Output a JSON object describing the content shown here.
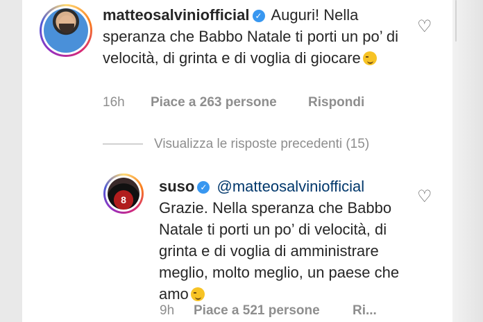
{
  "comments": [
    {
      "username": "matteosalviniofficial",
      "text": "Auguri! Nella speranza che Babbo Natale ti porti un po’ di velocità, di grinta e di voglia di giocare",
      "time": "16h",
      "likes": "Piace a 263 persone",
      "reply": "Rispondi"
    },
    {
      "username": "suso",
      "mention": "@matteosalviniofficial",
      "text": "Grazie. Nella speranza che Babbo Natale ti porti un po’ di velocità, di grinta e di voglia di amministrare meglio, molto meglio, un paese che amo",
      "time": "9h",
      "likes": "Piace a 521 persone",
      "reply": "Ri..."
    }
  ],
  "view_previous": "Visualizza le risposte precedenti (15)",
  "icons": {
    "heart": "heart-outline-icon",
    "verified": "verified-badge-icon",
    "emoji_wink": "winking-face-icon",
    "emoji_smirk": "smirking-face-icon"
  },
  "colors": {
    "text": "#262626",
    "muted": "#8e8e8e",
    "verified": "#3897f0",
    "mention": "#00376b"
  }
}
